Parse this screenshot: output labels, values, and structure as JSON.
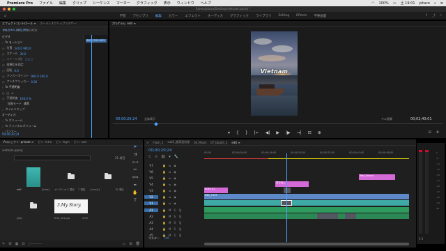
{
  "menubar": {
    "apple": "",
    "app_name": "Premiere Pro",
    "items": [
      "ファイル",
      "編集",
      "クリップ",
      "シーケンス",
      "マーカー",
      "グラフィック",
      "表示",
      "ウィンドウ",
      "ヘルプ"
    ],
    "battery": "100%",
    "clock": "土 19:01",
    "user": "pitaco"
  },
  "titlebar": {
    "path": "/Users/pitaco/Desktop/vietnam.prproj *"
  },
  "workspaces": {
    "items": [
      "学習",
      "アセンブリ",
      "編集",
      "カラー",
      "エフェクト",
      "オーディオ",
      "グラフィック",
      "ライブラリ",
      "Editing",
      "Effects",
      "不要画面"
    ],
    "active_index": 2
  },
  "effect_controls": {
    "tabs": [
      "エフェクトコントロール ≡",
      "オーディオクリップミキサー:"
    ],
    "source_label": "マスター・IMG_7553.MOV",
    "clip_label": "edit * IMG_7553.MOV",
    "clip_bar_label": "IMG_7553.MOV",
    "rows": [
      {
        "label": "ビデオ",
        "value": ""
      },
      {
        "label": "fx モーション",
        "value": ""
      },
      {
        "label": "位置",
        "value": "540.0   960.0"
      },
      {
        "label": "スケール",
        "value": "39.0"
      },
      {
        "label": "スケール(幅)",
        "value": "100.0"
      },
      {
        "label": "",
        "value": "縦横比を固定"
      },
      {
        "label": "回転",
        "value": "0.0"
      },
      {
        "label": "アンカーポイント",
        "value": "960.0   540.0"
      },
      {
        "label": "アンチフリッカー",
        "value": "0.00"
      },
      {
        "label": "fx 不透明度",
        "value": ""
      },
      {
        "label": "",
        "value": ""
      },
      {
        "label": "不透明度",
        "value": "100.0 %"
      },
      {
        "label": "描画モード",
        "value": "通常"
      },
      {
        "label": "タイムリマップ",
        "value": ""
      },
      {
        "label": "オーディオ",
        "value": ""
      },
      {
        "label": "fx ボリューム",
        "value": ""
      },
      {
        "label": "fx チャンネルボリューム",
        "value": ""
      },
      {
        "label": "パンナー",
        "value": ""
      }
    ],
    "timecode": "00;00;20;24"
  },
  "program_monitor": {
    "tab": "プログラム: edit ≡",
    "video_title": "Vietnam",
    "timecode": "00;00;20;24",
    "fit": "全体表示",
    "quality": "フル画質",
    "duration": "00;02;40;01",
    "transport": [
      "▾",
      "{",
      "}",
      "|←",
      "◀|",
      "▶",
      "|▶",
      "→|",
      "⊡",
      "⊕"
    ],
    "right_icons": [
      "⊞",
      "✚"
    ]
  },
  "project": {
    "tabs": [
      "プロジェクト: private ≡",
      "ピン: intro",
      "ピン: bgm",
      "ピン: outr"
    ],
    "file": "vietnam.prproj",
    "count": "21 項目",
    "items": [
      {
        "type": "video",
        "label": "edit",
        "duration": "2:40;01"
      },
      {
        "type": "folder",
        "label": "[intro]",
        "duration": "オーディオ 4 項目"
      },
      {
        "type": "folder",
        "label": "[music]",
        "duration": "7 項目"
      },
      {
        "type": "folder",
        "label": "[sfx]",
        "duration": "15 項目"
      },
      {
        "type": "folder",
        "label": "sub",
        "duration": "4 項目"
      },
      {
        "type": "image",
        "label": "title_001.jpg",
        "duration": "5;00",
        "image_text": "3.My Story."
      }
    ]
  },
  "timeline": {
    "tabs": [
      "Flash_1",
      "sub2_超高速処理",
      "04_Mood",
      "07_bbq04_2",
      "edit ≡"
    ],
    "timecode": "00;00;20;24",
    "ruler_ticks": [
      "00;00",
      "00;00;08;00",
      "00;00;16;00",
      "00;00;24;00",
      "00;00;32;00",
      "00;00;40;00",
      "00;00;48;00"
    ],
    "video_tracks": [
      "V7",
      "V6",
      "V5",
      "V4",
      "V3",
      "V2",
      "V1"
    ],
    "audio_tracks": [
      "A1",
      "A2",
      "A3",
      "A4",
      "A5"
    ],
    "clips_text": {
      "v4_pink": "Title_01",
      "v4_pink_right": "Text_Sound",
      "v3_pink": "書き出し",
      "v2_pink": "BGM_01",
      "v2_blue": "IMG_7553"
    },
    "master_label": "マスター",
    "master_value": "0.0"
  },
  "audio_meter": {
    "labels": [
      "0",
      "-6",
      "-12",
      "-18",
      "-24",
      "-30",
      "-36",
      "-42",
      "-48",
      "-54",
      "dB"
    ]
  },
  "colors": {
    "accent": "#4da3ff",
    "clip_pink": "#d46ad8",
    "clip_blue": "#5d89c9",
    "clip_teal": "#3fa9a6",
    "clip_green": "#2e9a5e"
  }
}
